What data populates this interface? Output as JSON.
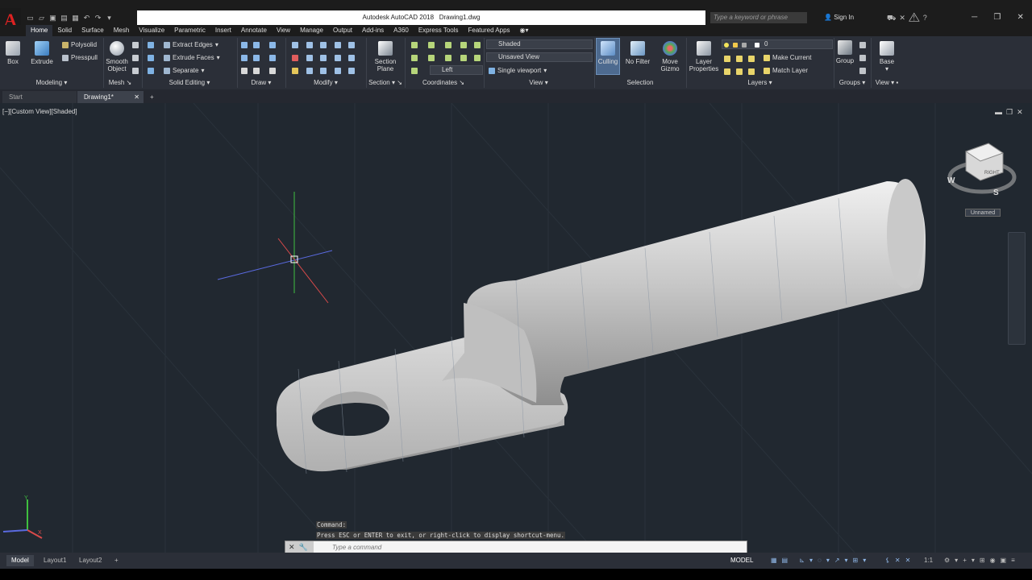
{
  "app": {
    "logo": "A",
    "title": "Autodesk AutoCAD 2018",
    "file": "Drawing1.dwg",
    "search_placeholder": "Type a keyword or phrase",
    "sign_in": "Sign In",
    "window_controls": [
      "─",
      "❐",
      "✕"
    ]
  },
  "menu_tabs": [
    "Home",
    "Solid",
    "Surface",
    "Mesh",
    "Visualize",
    "Parametric",
    "Insert",
    "Annotate",
    "View",
    "Manage",
    "Output",
    "Add-ins",
    "A360",
    "Express Tools",
    "Featured Apps"
  ],
  "ribbon": {
    "modeling": {
      "box": "Box",
      "extrude": "Extrude",
      "polysolid": "Polysolid",
      "presspull": "Presspull",
      "group": "Modeling"
    },
    "mesh": {
      "smooth": "Smooth",
      "object": "Object",
      "group": "Mesh"
    },
    "solid_editing": {
      "extract_edges": "Extract Edges",
      "extrude_faces": "Extrude Faces",
      "separate": "Separate",
      "group": "Solid Editing"
    },
    "draw": {
      "group": "Draw"
    },
    "modify": {
      "group": "Modify"
    },
    "section": {
      "plane1": "Section",
      "plane2": "Plane",
      "group": "Section"
    },
    "coordinates": {
      "ucs": "Left",
      "group": "Coordinates"
    },
    "view": {
      "visual_style": "Shaded",
      "named_view": "Unsaved View",
      "viewport": "Single viewport",
      "group": "View"
    },
    "selection": {
      "culling": "Culling",
      "no_filter": "No Filter",
      "move1": "Move",
      "move2": "Gizmo",
      "group": "Selection"
    },
    "layers": {
      "lp1": "Layer",
      "lp2": "Properties",
      "layer_value": "0",
      "make_current": "Make Current",
      "match_layer": "Match Layer",
      "group": "Layers"
    },
    "groups": {
      "group_btn": "Group",
      "group": "Groups"
    },
    "view2": {
      "base": "Base",
      "group": "View"
    }
  },
  "doc_tabs": [
    "Start",
    "Drawing1*"
  ],
  "viewport": {
    "label": "[−][Custom View][Shaded]",
    "viewcube_face": "RIGHT",
    "compass": [
      "W",
      "S"
    ],
    "ucs_label": "Unnamed",
    "axis_labels": {
      "x": "X",
      "y": "Y"
    }
  },
  "command": {
    "history": [
      "Command:",
      "Press ESC or ENTER to exit, or right-click to display shortcut-menu."
    ],
    "placeholder": "Type a command"
  },
  "layout_tabs": [
    "Model",
    "Layout1",
    "Layout2"
  ],
  "status": {
    "model": "MODEL",
    "scale": "1:1"
  },
  "colors": {
    "viewport_bg": "#212830",
    "ribbon_bg": "#2b2f38",
    "accent": "#2b6fb8"
  }
}
